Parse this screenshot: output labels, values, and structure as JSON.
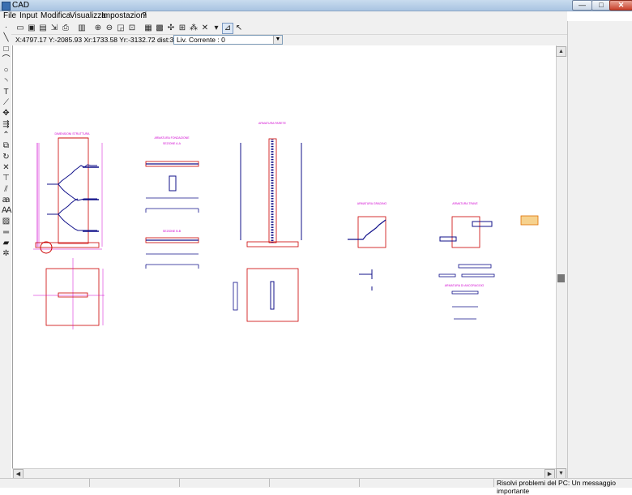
{
  "window": {
    "title": "CAD",
    "min_glyph": "—",
    "max_glyph": "□",
    "close_glyph": "✕"
  },
  "menu": [
    "File",
    "Input",
    "Modifica",
    "Visualizza",
    "Impostazioni",
    "?"
  ],
  "toolbar_icons": [
    "new-icon",
    "open-icon",
    "save-icon",
    "save-as-icon",
    "export-icon",
    "print-icon",
    "sep",
    "printer-icon",
    "sep",
    "zoom-in-icon",
    "zoom-out-icon",
    "zoom-window-icon",
    "zoom-extents-icon",
    "sep",
    "layers-icon",
    "grid-icon",
    "snap-icon",
    "ortho-icon",
    "grid-dots-icon",
    "delete-icon",
    "dropdown-icon",
    "polar-icon",
    "pointer-icon"
  ],
  "coords": {
    "text": "X:4797.17  Y:-2085.93 Xr:1733.58  Yr:-3132.72 dist:3580.40",
    "level": "Liv. Corrente : 0"
  },
  "left_tools": [
    "point-icon",
    "line-icon",
    "rect-icon",
    "arc-icon",
    "circle-icon",
    "curve-icon",
    "text-icon",
    "dimension-icon",
    "move-icon",
    "copy-icon",
    "trim-icon",
    "mirror-icon",
    "rotate-icon",
    "delete-x-icon",
    "extend-icon",
    "offset-icon",
    "dimension-aa-icon",
    "dimension-da-icon",
    "hatch-icon",
    "break-icon",
    "layer-tool-icon",
    "explode-icon"
  ],
  "drawing": {
    "labels": {
      "struttura": "DIMENSIONI STRUTTURA",
      "fondazione": "ARMATURA FONDAZIONE",
      "sezione_aa": "SEZIONE A-A",
      "sezione_bb": "SEZIONE B-B",
      "parete": "ARMATURA PARETE",
      "gradino": "ARMATURA GRADINO",
      "trave": "ARMATURA TRAVE",
      "ancoraggio": "ARMATURA DI ANCORAGGIO"
    }
  },
  "status": {
    "message": "Risolvi problemi del PC: Un messaggio importante"
  }
}
